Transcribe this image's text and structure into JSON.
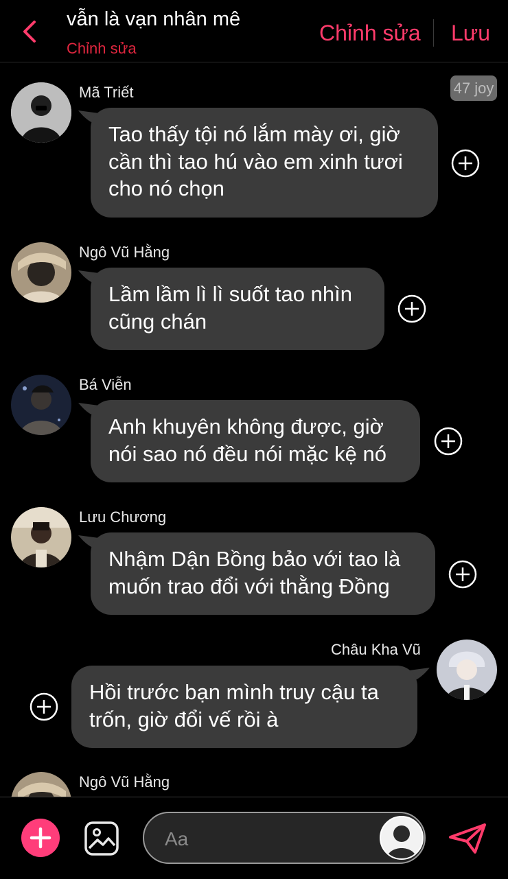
{
  "header": {
    "title": "vẫn là vạn nhân mê",
    "subtitle": "Chỉnh sửa",
    "edit_label": "Chỉnh sửa",
    "save_label": "Lưu"
  },
  "badge": {
    "text": "47 joy"
  },
  "messages": [
    {
      "sender": "Mã Triết",
      "text": "Tao thấy tội nó lắm mày ơi, giờ cần thì tao hú vào em xinh tươi cho nó chọn",
      "side": "left"
    },
    {
      "sender": "Ngô Vũ Hằng",
      "text": "Lầm lầm lì lì suốt tao nhìn cũng chán",
      "side": "left"
    },
    {
      "sender": "Bá Viễn",
      "text": "Anh khuyên không được, giờ nói sao nó đều nói mặc kệ nó",
      "side": "left"
    },
    {
      "sender": "Lưu Chương",
      "text": "Nhậm Dận Bồng bảo với tao là muốn trao đổi với thằng Đồng",
      "side": "left"
    },
    {
      "sender": "Châu Kha Vũ",
      "text": "Hồi trước bạn mình truy cậu ta trốn, giờ đổi vế rồi à",
      "side": "right"
    },
    {
      "sender": "Ngô Vũ Hằng",
      "text": "",
      "side": "left"
    }
  ],
  "composer": {
    "placeholder": "Aa"
  },
  "colors": {
    "accent": "#ff3b6b",
    "subtitle": "#e0263f",
    "bubble": "#3b3b3b",
    "background": "#000000"
  },
  "icons": [
    "chevron-left-icon",
    "plus-circle-icon",
    "add-icon",
    "image-icon",
    "send-icon",
    "avatar-icon"
  ]
}
